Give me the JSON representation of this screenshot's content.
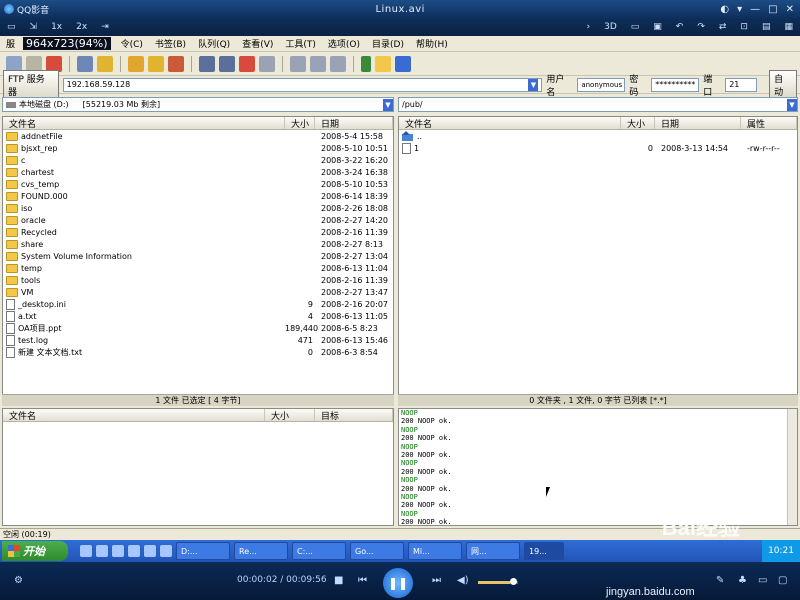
{
  "qq": {
    "app_title": "QQ影音",
    "file_title": "Linux.avi",
    "toolbar": [
      "1x",
      "2x"
    ],
    "toolbar_right": [
      "3D"
    ]
  },
  "ftp": {
    "menu_prefix": "服",
    "dimension_overlay": "964x723(94%)",
    "menu": [
      "令(C)",
      "书签(B)",
      "队列(Q)",
      "查看(V)",
      "工具(T)",
      "选项(O)",
      "目录(D)",
      "帮助(H)"
    ],
    "connection": {
      "server_button": "FTP 服务器",
      "host": "192.168.59.128",
      "user_label": "用户名",
      "user": "anonymous",
      "pass_label": "密码",
      "pass": "**********",
      "port_label": "端口",
      "port": "21",
      "auto_button": "自动"
    },
    "local": {
      "drive": "本地磁盘 (D:)",
      "free": "[55219.03 Mb 剩余]",
      "columns": [
        "文件名",
        "大小",
        "日期"
      ],
      "rows": [
        {
          "name": "addnetFile",
          "size": "",
          "date": "2008-5-4 15:58",
          "type": "folder"
        },
        {
          "name": "bjsxt_rep",
          "size": "",
          "date": "2008-5-10 10:51",
          "type": "folder"
        },
        {
          "name": "c",
          "size": "",
          "date": "2008-3-22 16:20",
          "type": "folder"
        },
        {
          "name": "chartest",
          "size": "",
          "date": "2008-3-24 16:38",
          "type": "folder"
        },
        {
          "name": "cvs_temp",
          "size": "",
          "date": "2008-5-10 10:53",
          "type": "folder"
        },
        {
          "name": "FOUND.000",
          "size": "",
          "date": "2008-6-14 18:39",
          "type": "folder"
        },
        {
          "name": "iso",
          "size": "",
          "date": "2008-2-26 18:08",
          "type": "folder"
        },
        {
          "name": "oracle",
          "size": "",
          "date": "2008-2-27 14:20",
          "type": "folder"
        },
        {
          "name": "Recycled",
          "size": "",
          "date": "2008-2-16 11:39",
          "type": "folder"
        },
        {
          "name": "share",
          "size": "",
          "date": "2008-2-27 8:13",
          "type": "folder"
        },
        {
          "name": "System Volume Information",
          "size": "",
          "date": "2008-2-27 13:04",
          "type": "folder"
        },
        {
          "name": "temp",
          "size": "",
          "date": "2008-6-13 11:04",
          "type": "folder"
        },
        {
          "name": "tools",
          "size": "",
          "date": "2008-2-16 11:39",
          "type": "folder"
        },
        {
          "name": "VM",
          "size": "",
          "date": "2008-2-27 13:47",
          "type": "folder"
        },
        {
          "name": "_desktop.ini",
          "size": "9",
          "date": "2008-2-16 20:07",
          "type": "file"
        },
        {
          "name": "a.txt",
          "size": "4",
          "date": "2008-6-13 11:05",
          "type": "file"
        },
        {
          "name": "OA项目.ppt",
          "size": "189,440",
          "date": "2008-6-5 8:23",
          "type": "file"
        },
        {
          "name": "test.log",
          "size": "471",
          "date": "2008-6-13 15:46",
          "type": "file"
        },
        {
          "name": "新建 文本文档.txt",
          "size": "0",
          "date": "2008-6-3 8:54",
          "type": "file"
        }
      ],
      "status": "1 文件 已选定 [ 4 字节]"
    },
    "remote": {
      "path": "/pub/",
      "columns": [
        "文件名",
        "大小",
        "日期",
        "属性"
      ],
      "rows": [
        {
          "name": "..",
          "size": "",
          "date": "",
          "attr": "",
          "type": "up"
        },
        {
          "name": "1",
          "size": "0",
          "date": "2008-3-13 14:54",
          "attr": "-rw-r--r--",
          "type": "file"
        }
      ],
      "status": "0 文件夹 , 1 文件, 0 字节 已列表 [*.*]"
    },
    "queue": {
      "columns": [
        "文件名",
        "大小",
        "目标"
      ]
    },
    "log": [
      "NOOP",
      "200 NOOP ok.",
      "NOOP",
      "200 NOOP ok.",
      "NOOP",
      "200 NOOP ok.",
      "NOOP",
      "200 NOOP ok.",
      "NOOP",
      "200 NOOP ok.",
      "NOOP",
      "200 NOOP ok.",
      "NOOP",
      "200 NOOP ok.",
      "NOOP",
      "200 NOOP ok.",
      "NOOP",
      "200 NOOP ok."
    ],
    "bottom_status": "空闲 (00:19)"
  },
  "taskbar": {
    "start": "开始",
    "tasks": [
      "D:...",
      "Re...",
      "C:...",
      "Go...",
      "Mi...",
      "网...",
      "19..."
    ],
    "clock": "10:21"
  },
  "player": {
    "time": "00:00:02 / 00:09:56",
    "volume_level": 0.8
  },
  "watermark": {
    "logo": "Bai经验",
    "url": "jingyan.baidu.com"
  }
}
